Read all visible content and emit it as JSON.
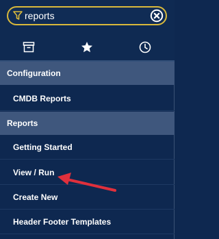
{
  "search": {
    "value": "reports",
    "icons": {
      "filter": "filter-icon",
      "clear": "clear-circle-icon"
    }
  },
  "tabs": [
    {
      "icon": "archive-box-icon"
    },
    {
      "icon": "star-icon"
    },
    {
      "icon": "clock-icon"
    }
  ],
  "sections": [
    {
      "header": "Configuration",
      "items": [
        {
          "label": "CMDB Reports"
        }
      ]
    },
    {
      "header": "Reports",
      "items": [
        {
          "label": "Getting Started"
        },
        {
          "label": "View / Run"
        },
        {
          "label": "Create New"
        },
        {
          "label": "Header Footer Templates"
        }
      ]
    }
  ],
  "colors": {
    "panel_bg": "#0e2850",
    "section_bg": "#3f577d",
    "search_border": "#d9b93b",
    "annotation_arrow": "#e0303c"
  }
}
